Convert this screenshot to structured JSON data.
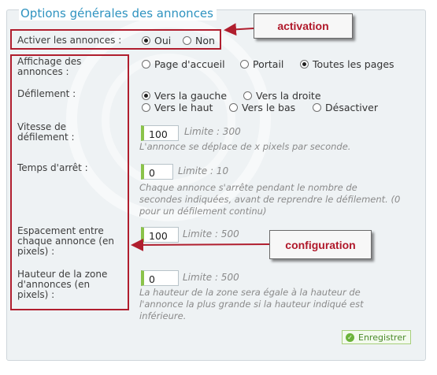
{
  "section_title": "Options générales des annonces",
  "fields": {
    "activer": {
      "label": "Activer les annonces :",
      "options": [
        "Oui",
        "Non"
      ],
      "selected": "Oui"
    },
    "affichage": {
      "label_line1": "Affichage des",
      "label_line2": "annonces :",
      "options": [
        "Page d'accueil",
        "Portail",
        "Toutes les pages"
      ],
      "selected": "Toutes les pages"
    },
    "defilement": {
      "label": "Défilement :",
      "options": [
        "Vers la gauche",
        "Vers la droite",
        "Vers le haut",
        "Vers le bas",
        "Désactiver"
      ],
      "selected": "Vers la gauche"
    },
    "vitesse": {
      "label_line1": "Vitesse de",
      "label_line2": "défilement :",
      "value": "100",
      "limit": "Limite : 300",
      "help": "L'annonce se déplace de x pixels par seconde."
    },
    "arret": {
      "label": "Temps d'arrêt :",
      "value": "0",
      "limit": "Limite : 10",
      "help_line1": "Chaque annonce s'arrête pendant le nombre de",
      "help_line2": "secondes indiquées, avant de reprendre le défilement. (0",
      "help_line3": "pour un défilement continu)"
    },
    "espacement": {
      "label_line1": "Espacement entre",
      "label_line2": "chaque annonce (en",
      "label_line3": "pixels) :",
      "value": "100",
      "limit": "Limite : 500"
    },
    "hauteur": {
      "label_line1": "Hauteur de la zone",
      "label_line2": "d'annonces (en",
      "label_line3": "pixels) :",
      "value": "0",
      "limit": "Limite : 500",
      "help_line1": "La hauteur de la zone sera égale à la hauteur de",
      "help_line2": "l'annonce la plus grande si la hauteur indiqué est",
      "help_line3": "inférieure."
    }
  },
  "save_label": "Enregistrer",
  "callouts": {
    "activation": "activation",
    "configuration": "configuration"
  },
  "colors": {
    "accent": "#2f93c0",
    "annotation": "#b01e2e",
    "input_marker": "#8bc34a"
  }
}
